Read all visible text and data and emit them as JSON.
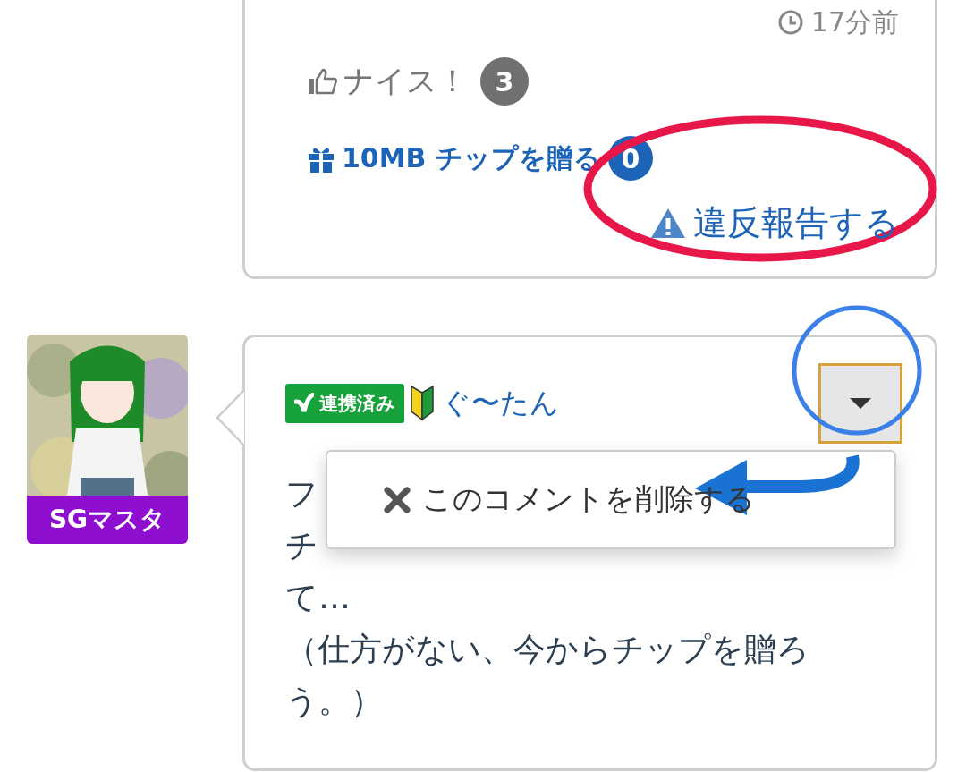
{
  "top_comment": {
    "timestamp": "17分前",
    "nice": {
      "label": "ナイス！",
      "count": "3"
    },
    "tip": {
      "label": "10MB チップを贈る",
      "count": "0"
    },
    "report": {
      "label": "違反報告する"
    }
  },
  "comment": {
    "avatar": {
      "kind": "picture",
      "rank": "SGマスタ"
    },
    "linked_badge": "連携済み",
    "beginner": true,
    "username": "ぐ〜たん",
    "menu_open": true,
    "menu": [
      {
        "label": "このコメントを削除する"
      }
    ],
    "body_lines": [
      "フ",
      "チ",
      "て…",
      "（仕方がない、今からチップを贈ろ",
      "う。）"
    ]
  },
  "annotations": [
    {
      "kind": "ellipse",
      "color": "#e8174a"
    },
    {
      "kind": "circle",
      "color": "#3b7fe8"
    },
    {
      "kind": "arrow",
      "color": "#1a72d2"
    }
  ]
}
